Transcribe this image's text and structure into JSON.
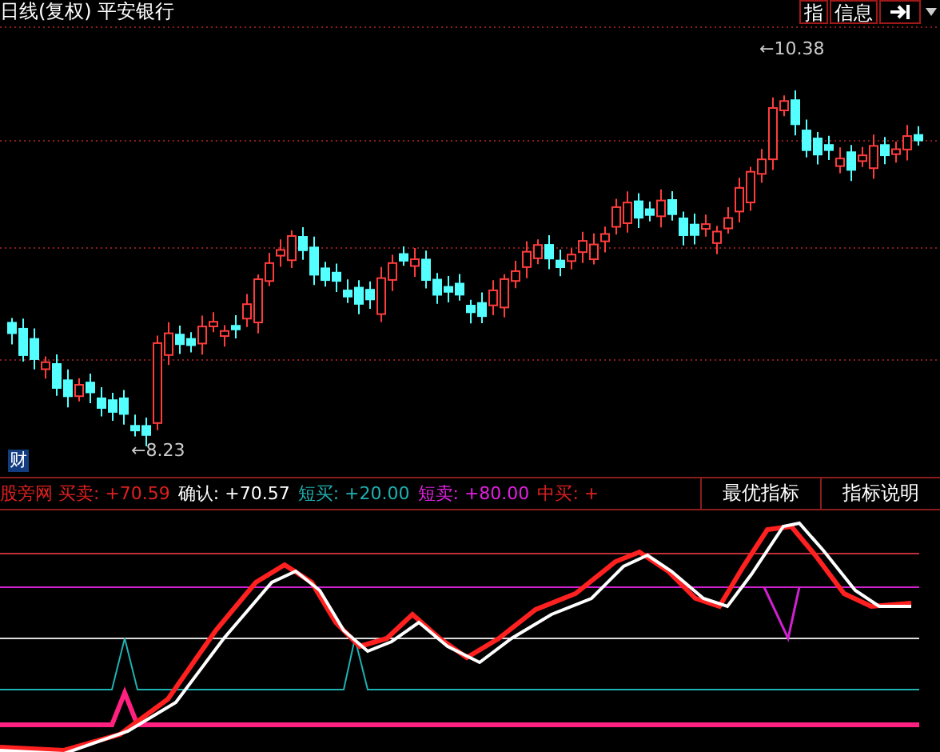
{
  "header": {
    "period": "日线(复权)",
    "stock": "平安银行",
    "buttons": [
      "指",
      "信息"
    ]
  },
  "main_chart": {
    "high_label": "←10.38",
    "low_label": "←8.23",
    "badge": "财"
  },
  "legend": [
    {
      "text": "股旁网 买卖: +70.59",
      "color": "#e02020"
    },
    {
      "text": "确认: +70.57",
      "color": "#ffffff"
    },
    {
      "text": "短买: +20.00",
      "color": "#20b0b0"
    },
    {
      "text": "短卖: +80.00",
      "color": "#e020e0"
    },
    {
      "text": "中买: +",
      "color": "#e02020"
    }
  ],
  "panel_buttons": [
    "最优指标",
    "指标说明"
  ]
}
